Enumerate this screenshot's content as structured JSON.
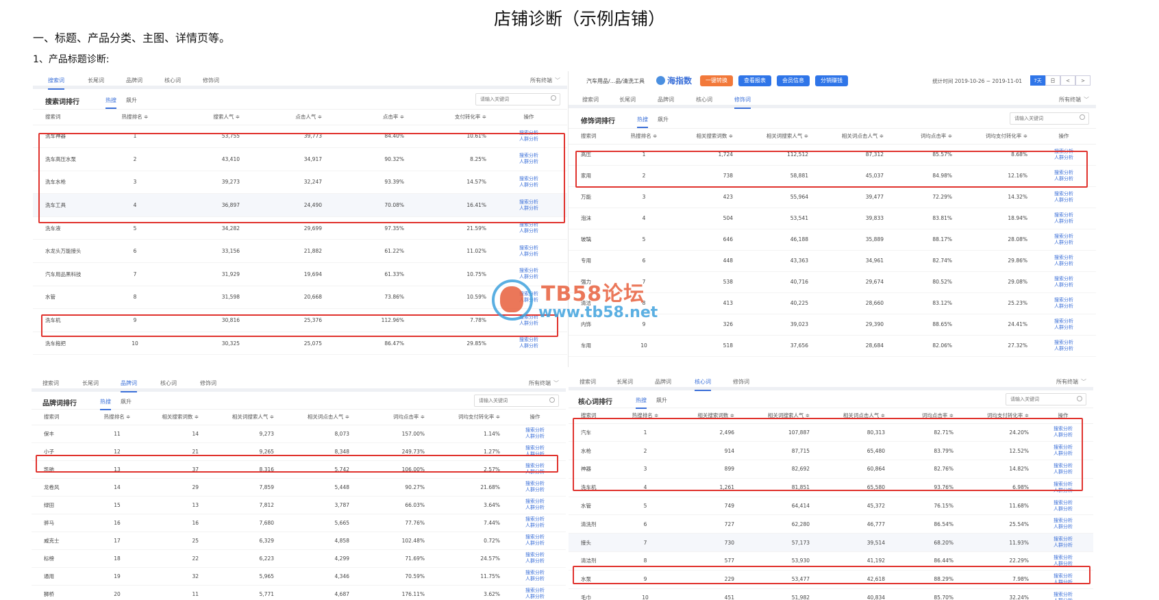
{
  "document": {
    "title": "店铺诊断（示例店铺）",
    "heading1": "一、标题、产品分类、主图、详情页等。",
    "heading2": "1、产品标题诊断:"
  },
  "colors": {
    "accent": "#3a6fd8",
    "highlight_box": "#e0312c",
    "orange_btn": "#f2793a",
    "blue_btn": "#2f75e8"
  },
  "tabs": [
    "搜索词",
    "长尾词",
    "品牌词",
    "核心词",
    "修饰词"
  ],
  "filter_label": "所有终端",
  "sub_tabs": [
    "热搜",
    "飙升"
  ],
  "search_placeholder": "请输入关键词",
  "ops": [
    "搜索分析",
    "人群分析"
  ],
  "watermark": {
    "line1": "TB58论坛",
    "line2": "www.tb58.net"
  },
  "panel_search": {
    "rank_title": "搜索词排行",
    "headers": [
      "搜索词",
      "热搜排名 ≑",
      "搜索人气 ≑",
      "点击人气 ≑",
      "点击率 ≑",
      "支付转化率 ≑",
      "操作"
    ],
    "rows": [
      [
        "洗车神器",
        "1",
        "53,755",
        "39,773",
        "84.40%",
        "10.61%"
      ],
      [
        "洗车高压水泵",
        "2",
        "43,410",
        "34,917",
        "90.32%",
        "8.25%"
      ],
      [
        "洗车水枪",
        "3",
        "39,273",
        "32,247",
        "93.39%",
        "14.57%"
      ],
      [
        "洗车工具",
        "4",
        "36,897",
        "24,490",
        "70.08%",
        "16.41%"
      ],
      [
        "洗车液",
        "5",
        "34,282",
        "29,699",
        "97.35%",
        "21.59%"
      ],
      [
        "水龙头万能接头",
        "6",
        "33,156",
        "21,882",
        "61.22%",
        "11.02%"
      ],
      [
        "汽车用品黑科技",
        "7",
        "31,929",
        "19,694",
        "61.33%",
        "10.75%"
      ],
      [
        "水管",
        "8",
        "31,598",
        "20,668",
        "73.86%",
        "10.59%"
      ],
      [
        "洗车机",
        "9",
        "30,816",
        "25,376",
        "112.96%",
        "7.78%"
      ],
      [
        "洗车拖把",
        "10",
        "30,325",
        "25,075",
        "86.47%",
        "29.85%"
      ]
    ]
  },
  "panel_modifier": {
    "topbar": {
      "crumb": "汽车用品/...品/清洗工具",
      "logo": "海指数",
      "buttons": [
        "一键转换",
        "查看报表",
        "会员信息",
        "分销赚钱"
      ],
      "date": "统计时间 2019-10-26 ~ 2019-11-01",
      "pills": [
        "7天",
        "日",
        "<",
        ">"
      ]
    },
    "rank_title": "修饰词排行",
    "headers": [
      "搜索词",
      "热搜排名 ≑",
      "相关搜索词数 ≑",
      "相关词搜索人气 ≑",
      "相关词点击人气 ≑",
      "词均点击率 ≑",
      "词均支付转化率 ≑",
      "操作"
    ],
    "rows": [
      [
        "高压",
        "1",
        "1,724",
        "112,512",
        "87,312",
        "85.57%",
        "8.68%"
      ],
      [
        "家用",
        "2",
        "738",
        "58,881",
        "45,037",
        "84.98%",
        "12.16%"
      ],
      [
        "万能",
        "3",
        "423",
        "55,964",
        "39,477",
        "72.29%",
        "14.32%"
      ],
      [
        "泡沫",
        "4",
        "504",
        "53,541",
        "39,833",
        "83.81%",
        "18.94%"
      ],
      [
        "玻璃",
        "5",
        "646",
        "46,188",
        "35,889",
        "88.17%",
        "28.08%"
      ],
      [
        "专用",
        "6",
        "448",
        "43,363",
        "34,961",
        "82.74%",
        "29.86%"
      ],
      [
        "强力",
        "7",
        "538",
        "40,716",
        "29,674",
        "80.52%",
        "29.08%"
      ],
      [
        "清洁",
        "8",
        "413",
        "40,225",
        "28,660",
        "83.12%",
        "25.23%"
      ],
      [
        "内饰",
        "9",
        "326",
        "39,023",
        "29,390",
        "88.65%",
        "24.41%"
      ],
      [
        "车用",
        "10",
        "518",
        "37,656",
        "28,684",
        "82.06%",
        "27.32%"
      ]
    ]
  },
  "panel_brand": {
    "rank_title": "品牌词排行",
    "headers": [
      "搜索词",
      "热搜排名 ≑",
      "相关搜索词数 ≑",
      "相关词搜索人气 ≑",
      "相关词点击人气 ≑",
      "词均点击率 ≑",
      "词均支付转化率 ≑",
      "操作"
    ],
    "rows": [
      [
        "保丰",
        "11",
        "14",
        "9,273",
        "8,073",
        "157.00%",
        "1.14%"
      ],
      [
        "小子",
        "12",
        "21",
        "9,265",
        "8,348",
        "249.73%",
        "1.27%"
      ],
      [
        "凯驰",
        "13",
        "37",
        "8,316",
        "5,742",
        "106.00%",
        "2.57%"
      ],
      [
        "龙卷风",
        "14",
        "29",
        "7,859",
        "5,448",
        "90.27%",
        "21.68%"
      ],
      [
        "绿田",
        "15",
        "13",
        "7,812",
        "3,787",
        "66.03%",
        "3.64%"
      ],
      [
        "骅马",
        "16",
        "16",
        "7,680",
        "5,665",
        "77.76%",
        "7.44%"
      ],
      [
        "威克士",
        "17",
        "25",
        "6,329",
        "4,858",
        "102.48%",
        "0.72%"
      ],
      [
        "标榜",
        "18",
        "22",
        "6,223",
        "4,299",
        "71.69%",
        "24.57%"
      ],
      [
        "通用",
        "19",
        "32",
        "5,965",
        "4,346",
        "70.59%",
        "11.75%"
      ],
      [
        "狮桥",
        "20",
        "11",
        "5,771",
        "4,687",
        "176.11%",
        "3.62%"
      ]
    ]
  },
  "panel_core": {
    "rank_title": "核心词排行",
    "headers": [
      "搜索词",
      "热搜排名 ≑",
      "相关搜索词数 ≑",
      "相关词搜索人气 ≑",
      "相关词点击人气 ≑",
      "词均点击率 ≑",
      "词均支付转化率 ≑",
      "操作"
    ],
    "rows": [
      [
        "汽车",
        "1",
        "2,496",
        "107,887",
        "80,313",
        "82.71%",
        "24.20%"
      ],
      [
        "水枪",
        "2",
        "914",
        "87,715",
        "65,480",
        "83.79%",
        "12.52%"
      ],
      [
        "神器",
        "3",
        "899",
        "82,692",
        "60,864",
        "82.76%",
        "14.82%"
      ],
      [
        "洗车机",
        "4",
        "1,261",
        "81,851",
        "65,580",
        "93.76%",
        "6.98%"
      ],
      [
        "水管",
        "5",
        "749",
        "64,414",
        "45,372",
        "76.15%",
        "11.68%"
      ],
      [
        "清洗剂",
        "6",
        "727",
        "62,280",
        "46,777",
        "86.54%",
        "25.54%"
      ],
      [
        "接头",
        "7",
        "730",
        "57,173",
        "39,514",
        "68.20%",
        "11.93%"
      ],
      [
        "清洁剂",
        "8",
        "577",
        "53,930",
        "41,192",
        "86.44%",
        "22.29%"
      ],
      [
        "水泵",
        "9",
        "229",
        "53,477",
        "42,618",
        "88.29%",
        "7.98%"
      ],
      [
        "毛巾",
        "10",
        "451",
        "51,982",
        "40,834",
        "85.70%",
        "32.24%"
      ]
    ]
  }
}
